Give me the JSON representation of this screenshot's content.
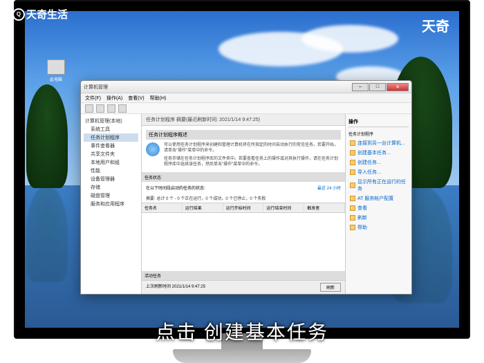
{
  "brand": {
    "logo_text": "天奇生活",
    "logo_glyph": "Q"
  },
  "watermark": "天奇",
  "desktop": {
    "icon_label": "此电脑"
  },
  "caption": "点击 创建基本任务",
  "window": {
    "title": "计算机管理",
    "menu": [
      "文件(F)",
      "操作(A)",
      "查看(V)",
      "帮助(H)"
    ],
    "win_controls": {
      "min": "–",
      "max": "□",
      "close": "✕"
    }
  },
  "left_tree": {
    "root": "计算机管理(本地)",
    "items": [
      "系统工具",
      "任务计划程序",
      "事件查看器",
      "共享文件夹",
      "本地用户和组",
      "性能",
      "设备管理器",
      "存储",
      "磁盘管理",
      "服务和应用程序"
    ]
  },
  "center": {
    "header": "任务计划程序 摘要(最近刷新时间: 2021/1/14 9:47:25)",
    "overview_title": "任务计划程序概述",
    "overview_text1": "可以使用任务计划程序来创建和管理计算机将在所指定的时间自动执行的常见任务。若要开始，请单击\"操作\"菜单中的命令。",
    "overview_text2": "任务存储在任务计划程序库的文件夹中。若要查看任务上的操作或对其执行操作，请在任务计划程序库中选择该任务，然后单击\"操作\"菜单中的命令。",
    "status_title": "任务状态",
    "status_label": "在以下时间段启动的任务的状态:",
    "status_value": "最近 24 小时",
    "summary": "摘要: 总计 0 个 - 0 个正在运行，0 个成功，0 个已停止，0 个失败",
    "columns": [
      "任务名",
      "运行结果",
      "运行开始时间",
      "运行结束时间",
      "触发者"
    ],
    "active_title": "活动任务",
    "footer_label": "上次刷新时间 2021/1/14 9:47:25",
    "refresh_btn": "刷新"
  },
  "actions": {
    "header": "操作",
    "group": "任务计划程序",
    "items": [
      "连接到另一台计算机...",
      "创建基本任务...",
      "创建任务...",
      "导入任务...",
      "显示所有正在运行的任务",
      "AT 服务帐户配置",
      "查看",
      "刷新",
      "帮助"
    ]
  }
}
